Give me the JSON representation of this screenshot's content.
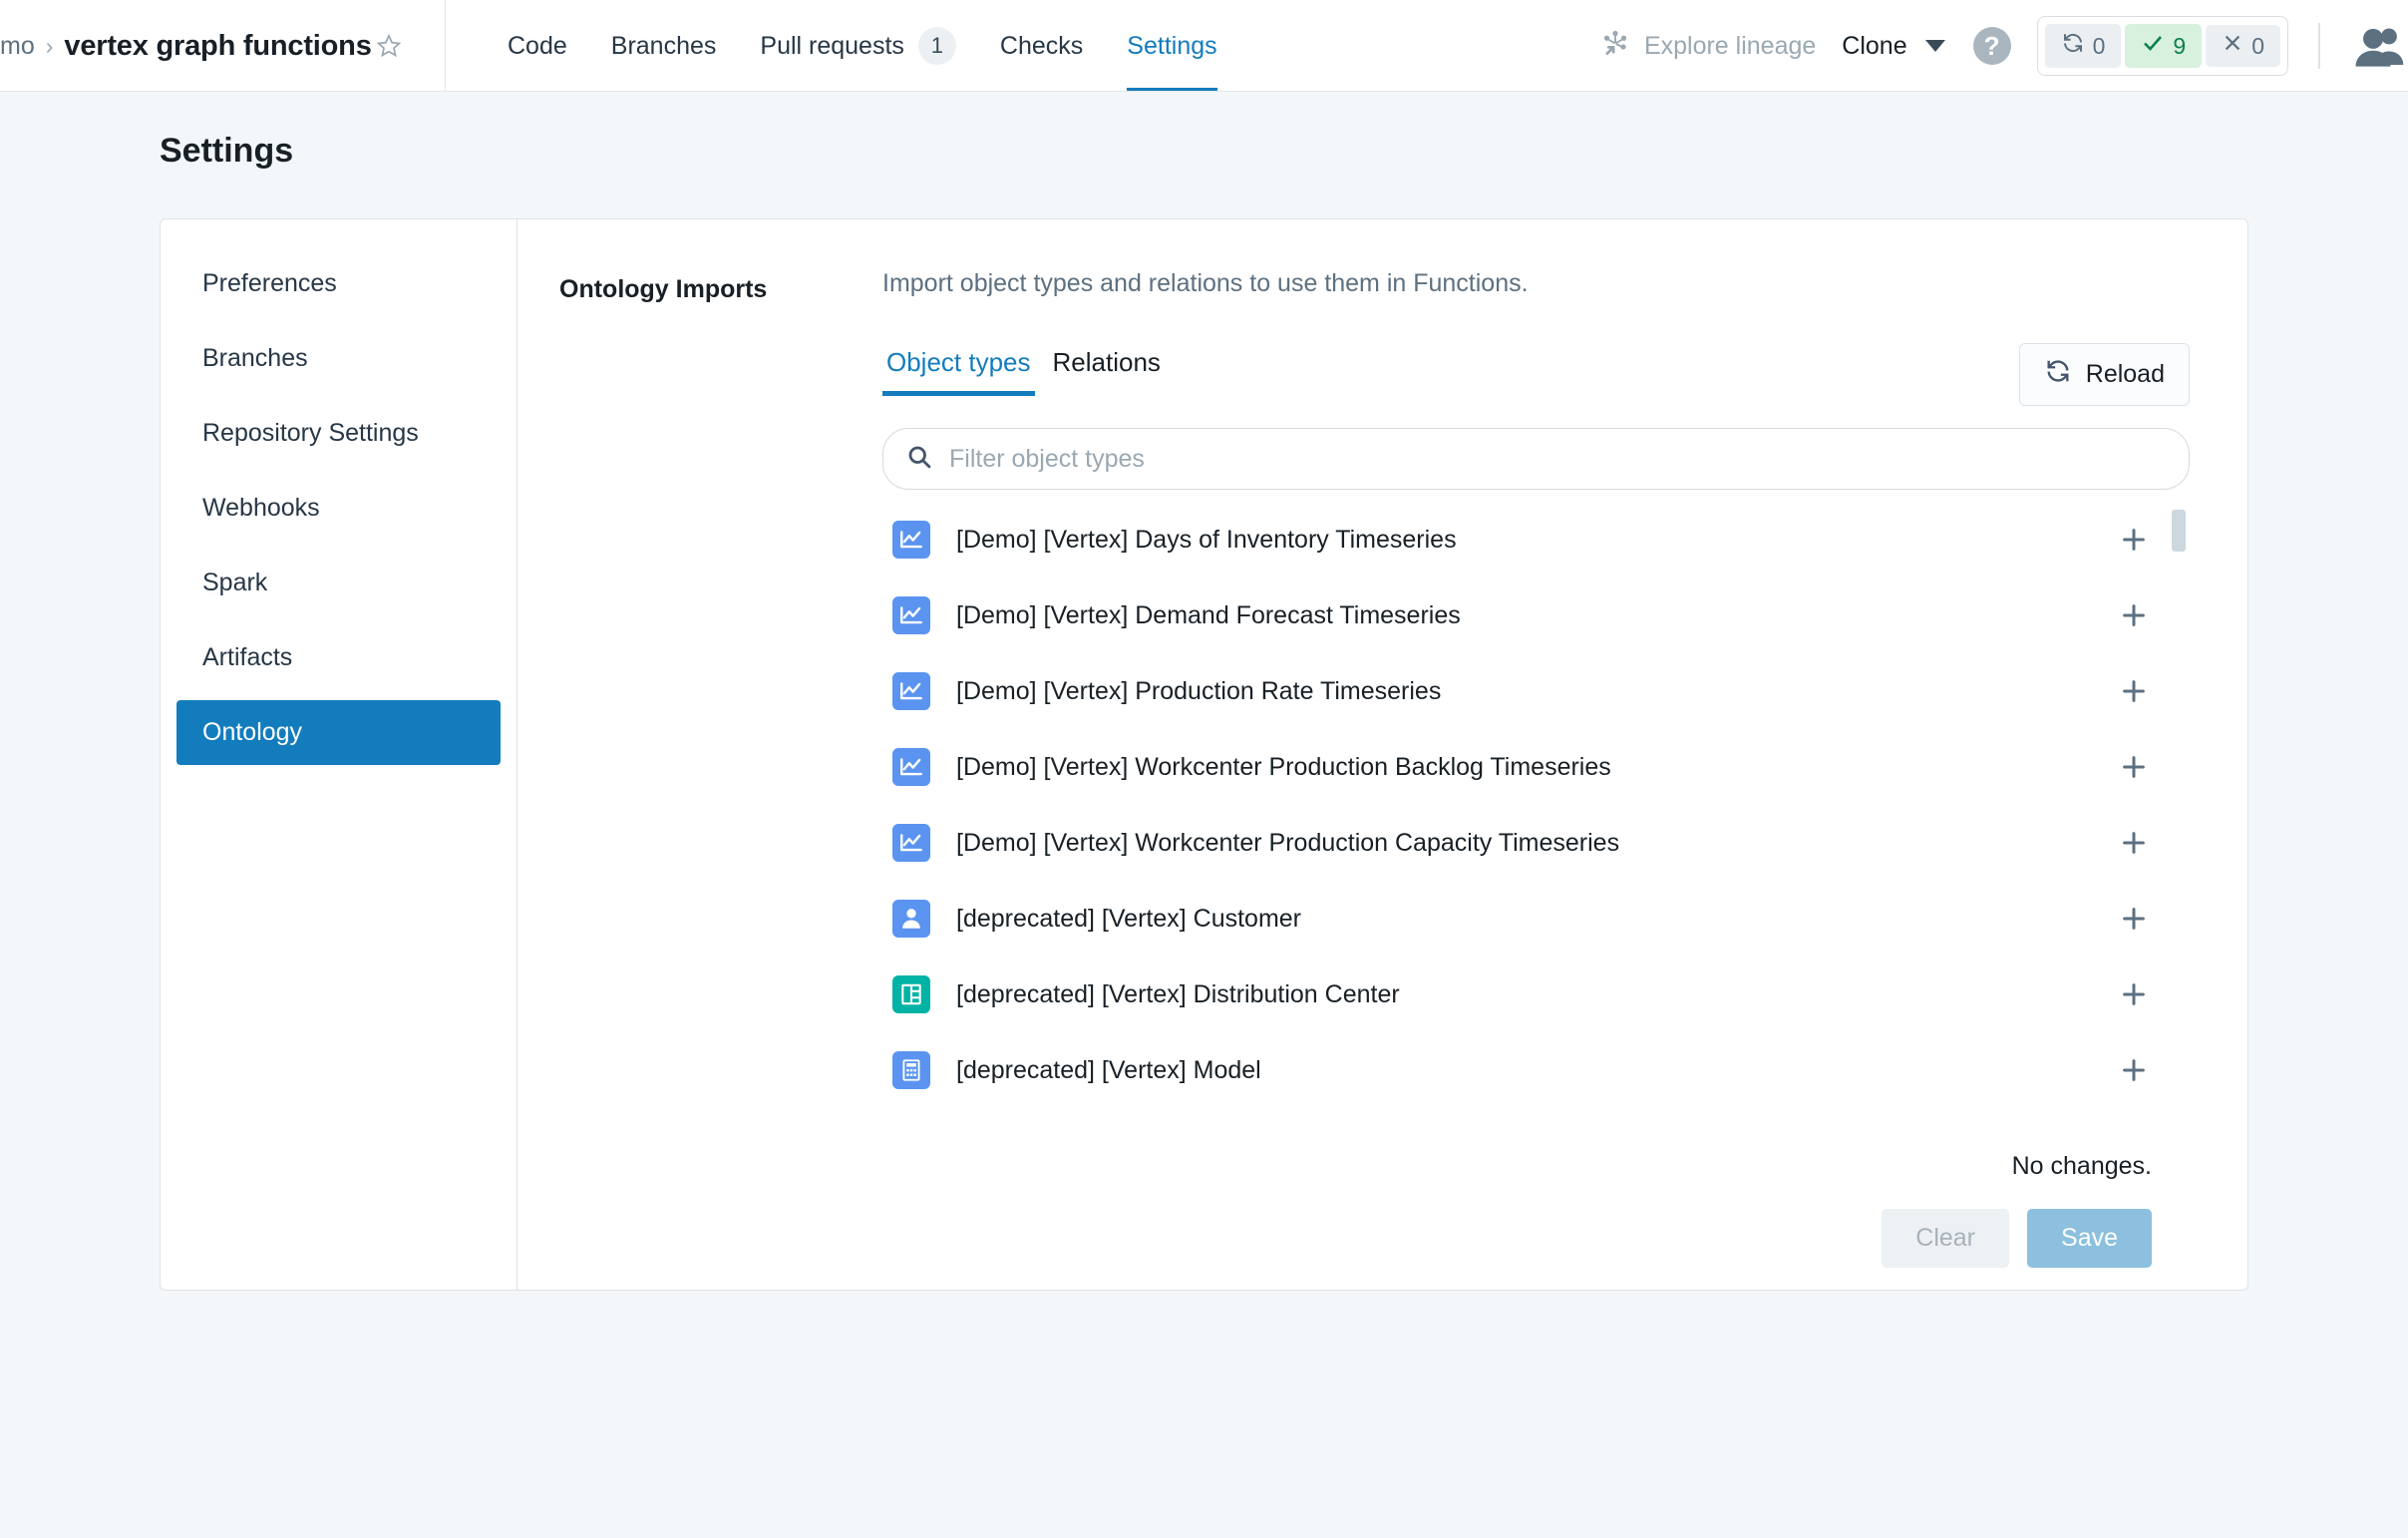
{
  "topbar": {
    "breadcrumb": {
      "parent": "mo",
      "separator": "›",
      "current": "vertex graph functions",
      "star_icon": "star-icon"
    },
    "nav": [
      {
        "label": "Code",
        "active": false,
        "badge": null
      },
      {
        "label": "Branches",
        "active": false,
        "badge": null
      },
      {
        "label": "Pull requests",
        "active": false,
        "badge": "1"
      },
      {
        "label": "Checks",
        "active": false,
        "badge": null
      },
      {
        "label": "Settings",
        "active": true,
        "badge": null
      }
    ],
    "lineage": {
      "label": "Explore lineage",
      "icon": "lineage-graph-icon"
    },
    "clone": {
      "label": "Clone",
      "icon": "chevron-down-icon"
    },
    "help": {
      "label": "?",
      "icon": "help-circle-icon"
    },
    "build_status": [
      {
        "icon": "refresh-icon",
        "count": "0",
        "state": "pending"
      },
      {
        "icon": "check-icon",
        "count": "9",
        "state": "success"
      },
      {
        "icon": "x-icon",
        "count": "0",
        "state": "failed"
      }
    ],
    "avatar": {
      "icon": "users-avatar-icon"
    }
  },
  "page": {
    "title": "Settings"
  },
  "sidebar": {
    "items": [
      {
        "label": "Preferences",
        "active": false
      },
      {
        "label": "Branches",
        "active": false
      },
      {
        "label": "Repository Settings",
        "active": false
      },
      {
        "label": "Webhooks",
        "active": false
      },
      {
        "label": "Spark",
        "active": false
      },
      {
        "label": "Artifacts",
        "active": false
      },
      {
        "label": "Ontology",
        "active": true
      }
    ]
  },
  "main": {
    "section_label": "Ontology Imports",
    "description": "Import object types and relations to use them in Functions.",
    "tabs": [
      {
        "label": "Object types",
        "active": true
      },
      {
        "label": "Relations",
        "active": false
      }
    ],
    "reload_button": {
      "label": "Reload",
      "icon": "refresh-icon"
    },
    "search": {
      "value": "",
      "placeholder": "Filter object types",
      "icon": "search-icon"
    },
    "list": [
      {
        "label": "[Demo] [Vertex] Days of Inventory Timeseries",
        "icon": "timeseries-chart-icon",
        "icon_color": "#5b94f0",
        "add_icon": "plus-icon"
      },
      {
        "label": "[Demo] [Vertex] Demand Forecast Timeseries",
        "icon": "timeseries-chart-icon",
        "icon_color": "#5b94f0",
        "add_icon": "plus-icon"
      },
      {
        "label": "[Demo] [Vertex] Production Rate Timeseries",
        "icon": "timeseries-chart-icon",
        "icon_color": "#5b94f0",
        "add_icon": "plus-icon"
      },
      {
        "label": "[Demo] [Vertex] Workcenter Production Backlog Timeseries",
        "icon": "timeseries-chart-icon",
        "icon_color": "#5b94f0",
        "add_icon": "plus-icon"
      },
      {
        "label": "[Demo] [Vertex] Workcenter Production Capacity Timeseries",
        "icon": "timeseries-chart-icon",
        "icon_color": "#5b94f0",
        "add_icon": "plus-icon"
      },
      {
        "label": "[deprecated] [Vertex] Customer",
        "icon": "person-icon",
        "icon_color": "#5b94f0",
        "add_icon": "plus-icon"
      },
      {
        "label": "[deprecated] [Vertex] Distribution Center",
        "icon": "warehouse-icon",
        "icon_color": "#00b3a4",
        "add_icon": "plus-icon"
      },
      {
        "label": "[deprecated] [Vertex] Model",
        "icon": "calculator-icon",
        "icon_color": "#5b94f0",
        "add_icon": "plus-icon"
      }
    ],
    "status_text": "No changes.",
    "clear_button": "Clear",
    "save_button": "Save"
  },
  "colors": {
    "accent": "#137cbd",
    "page_bg": "#f3f7f9",
    "success": "#0d8050",
    "teal": "#00b3a4",
    "icon_blue": "#5b94f0",
    "save_disabled": "#8cc0de"
  }
}
